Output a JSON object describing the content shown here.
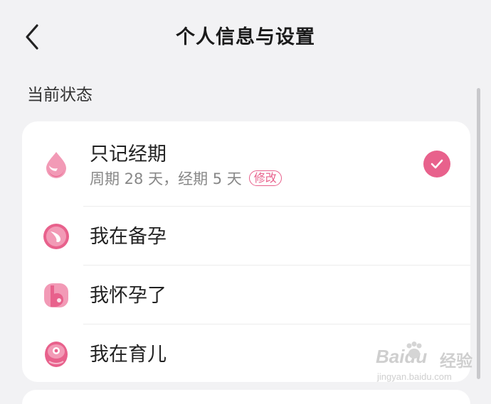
{
  "header": {
    "title": "个人信息与设置",
    "back_icon": "chevron-left-icon"
  },
  "section": {
    "label": "当前状态"
  },
  "status_options": [
    {
      "label": "只记经期",
      "icon": "drop-icon",
      "subtitle": "周期 28 天，经期 5 天",
      "edit_label": "修改",
      "selected": true
    },
    {
      "label": "我在备孕",
      "icon": "ovum-icon",
      "selected": false
    },
    {
      "label": "我怀孕了",
      "icon": "pregnant-icon",
      "selected": false
    },
    {
      "label": "我在育儿",
      "icon": "baby-icon",
      "selected": false
    }
  ],
  "colors": {
    "accent": "#e8618c",
    "icon_light": "#f29ab6",
    "background": "#f2f2f4",
    "card": "#ffffff"
  },
  "watermark": {
    "brand": "Baidu",
    "suffix": "经验",
    "url": "jingyan.baidu.com"
  }
}
